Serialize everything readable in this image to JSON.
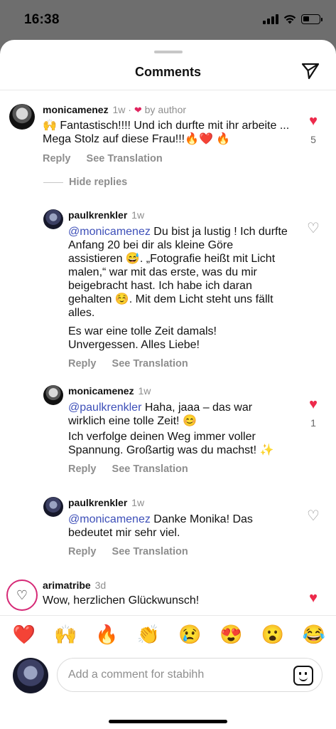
{
  "status": {
    "time": "16:38"
  },
  "header": {
    "title": "Comments"
  },
  "icons": {
    "share": "send-icon",
    "sticker": "sticker-icon"
  },
  "colors": {
    "like_red": "#ed2a4b",
    "mention": "#3d4fb8"
  },
  "comments": [
    {
      "user": "monicamenez",
      "time": "1w",
      "dot": "·",
      "by_author": "by author",
      "text": "🙌 Fantastisch!!!! Und ich durfte mit ihr arbeite ... Mega Stolz auf diese Frau!!!🔥❤️ 🔥",
      "reply": "Reply",
      "translate": "See Translation",
      "likes": "5"
    },
    {
      "user": "paulkrenkler",
      "time": "1w",
      "mention": "@monicamenez",
      "text": " Du bist ja lustig ! Ich durfte Anfang 20 bei dir als kleine Göre assistieren 😅. „Fotografie heißt mit Licht malen,“ war mit das erste, was du mir beigebracht hast. Ich habe ich daran gehalten ☺️. Mit dem Licht steht uns fällt alles.",
      "text2": "Es war eine tolle Zeit damals! Unvergessen. Alles Liebe!",
      "reply": "Reply",
      "translate": "See Translation"
    },
    {
      "user": "monicamenez",
      "time": "1w",
      "mention": "@paulkrenkler",
      "text": " Haha, jaaa – das war wirklich eine tolle Zeit! 😊",
      "text2": "Ich verfolge deinen Weg immer voller Spannung. Großartig was du machst! ✨",
      "reply": "Reply",
      "translate": "See Translation",
      "likes": "1"
    },
    {
      "user": "paulkrenkler",
      "time": "1w",
      "mention": "@monicamenez",
      "text": "  Danke Monika! Das bedeutet mir sehr viel.",
      "reply": "Reply",
      "translate": "See Translation"
    },
    {
      "user": "arimatribe",
      "time": "3d",
      "text": "Wow, herzlichen Glückwunsch!"
    }
  ],
  "hide_replies": "Hide replies",
  "emojis": [
    "❤️",
    "🙌",
    "🔥",
    "👏",
    "😢",
    "😍",
    "😮",
    "😂"
  ],
  "input": {
    "placeholder": "Add a comment for stabihh"
  }
}
